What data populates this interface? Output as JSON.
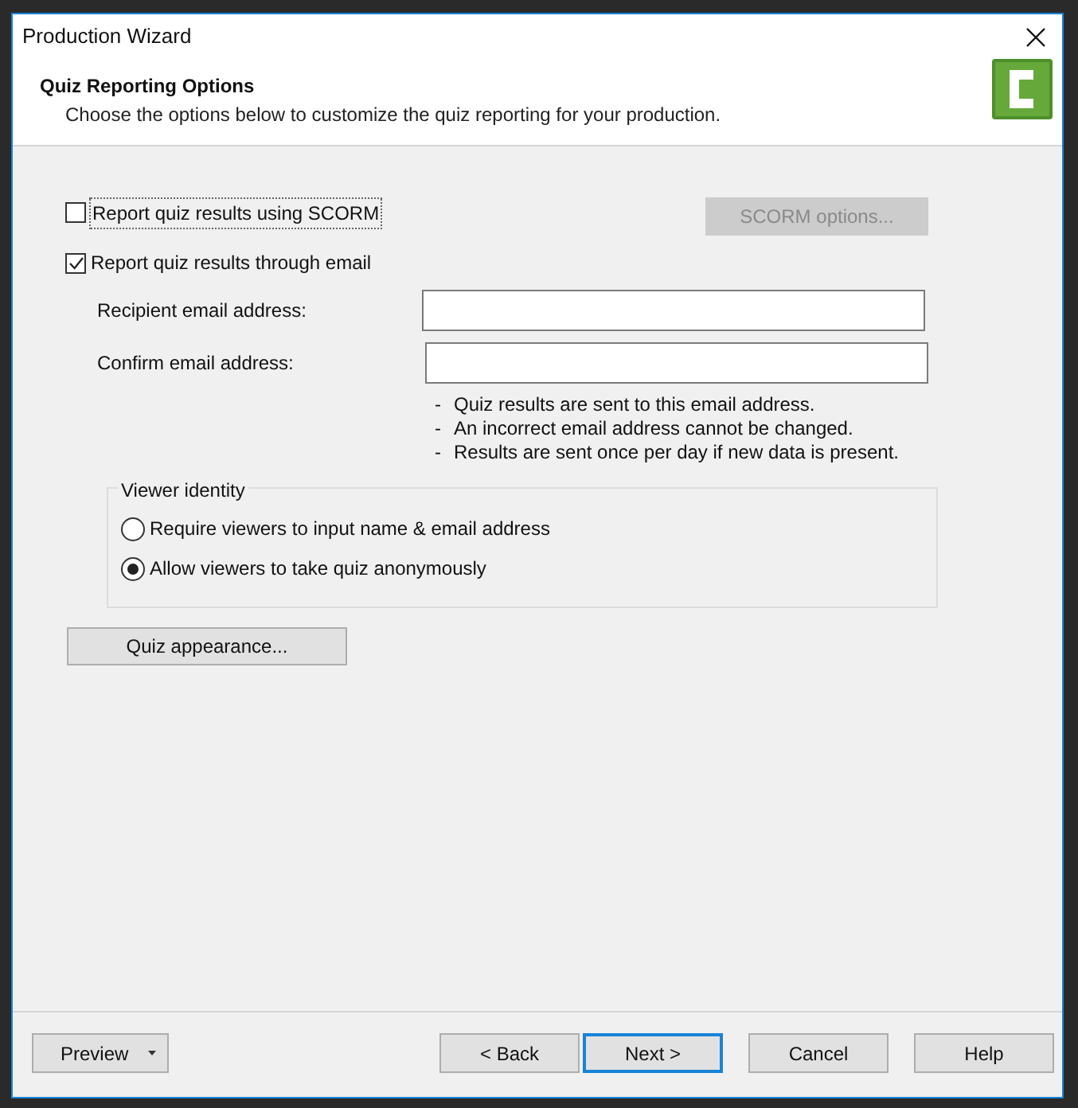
{
  "window": {
    "title": "Production Wizard"
  },
  "header": {
    "title": "Quiz Reporting Options",
    "subtitle": "Choose the options below to customize the quiz reporting for your production."
  },
  "scorm": {
    "label": "Report quiz results using SCORM",
    "checked": false,
    "button": {
      "label": "SCORM options...",
      "disabled": true
    }
  },
  "email": {
    "label": "Report quiz results through email",
    "checked": true,
    "fields": [
      {
        "label": "Recipient email address:"
      },
      {
        "label": "Confirm email address:"
      }
    ],
    "notes": [
      {
        "bullet": "-",
        "text": "Quiz results are sent to this email address."
      },
      {
        "bullet": "-",
        "text": "An incorrect email address cannot be changed."
      },
      {
        "bullet": "-",
        "text": "Results are sent once per day if new data is present."
      }
    ]
  },
  "viewer_identity": {
    "title": "Viewer identity",
    "options": [
      {
        "label": "Require viewers to input name & email address",
        "selected": false
      },
      {
        "label": "Allow viewers to take quiz anonymously",
        "selected": true
      }
    ]
  },
  "appearance_button": "Quiz appearance...",
  "footer": {
    "preview": "Preview",
    "buttons": [
      {
        "label": "< Back",
        "default": false
      },
      {
        "label": "Next >",
        "default": true
      },
      {
        "label": "Cancel",
        "default": false
      },
      {
        "label": "Help",
        "default": false
      }
    ]
  }
}
